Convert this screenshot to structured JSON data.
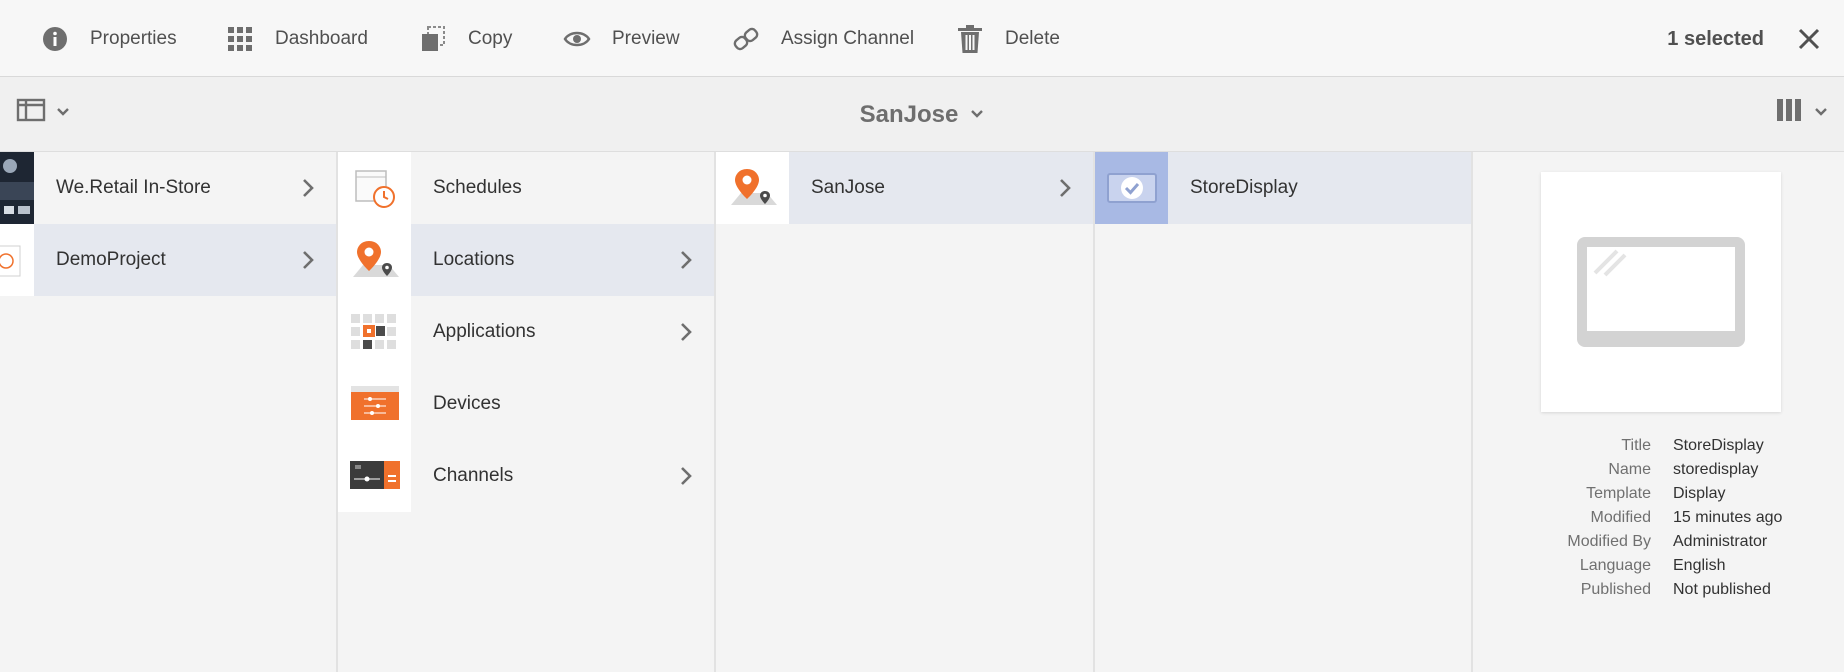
{
  "actionbar": {
    "actions": [
      {
        "label": "Properties",
        "icon": "info-icon"
      },
      {
        "label": "Dashboard",
        "icon": "grid-icon"
      },
      {
        "label": "Copy",
        "icon": "copy-icon"
      },
      {
        "label": "Preview",
        "icon": "eye-icon"
      },
      {
        "label": "Assign Channel",
        "icon": "link-icon"
      },
      {
        "label": "Delete",
        "icon": "trash-icon"
      }
    ],
    "selected_count": "1 selected"
  },
  "titlebar": {
    "title": "SanJose"
  },
  "columns": {
    "col1": [
      {
        "label": "We.Retail In-Store",
        "has_children": true
      },
      {
        "label": "DemoProject",
        "has_children": true,
        "active": true
      }
    ],
    "col2": [
      {
        "label": "Schedules",
        "has_children": false
      },
      {
        "label": "Locations",
        "has_children": true,
        "active": true
      },
      {
        "label": "Applications",
        "has_children": true
      },
      {
        "label": "Devices",
        "has_children": false
      },
      {
        "label": "Channels",
        "has_children": true
      }
    ],
    "col3": [
      {
        "label": "SanJose",
        "has_children": true,
        "active": true
      }
    ],
    "col4": [
      {
        "label": "StoreDisplay",
        "has_children": false,
        "selected": true
      }
    ]
  },
  "preview": {
    "metadata": [
      {
        "key": "Title",
        "value": "StoreDisplay"
      },
      {
        "key": "Name",
        "value": "storedisplay"
      },
      {
        "key": "Template",
        "value": "Display"
      },
      {
        "key": "Modified",
        "value": "15 minutes ago"
      },
      {
        "key": "Modified By",
        "value": "Administrator"
      },
      {
        "key": "Language",
        "value": "English"
      },
      {
        "key": "Published",
        "value": "Not published"
      }
    ]
  },
  "colors": {
    "accent_orange": "#f0712c",
    "selection_blue": "#a8b9e4",
    "active_row": "#e5e8ef"
  }
}
